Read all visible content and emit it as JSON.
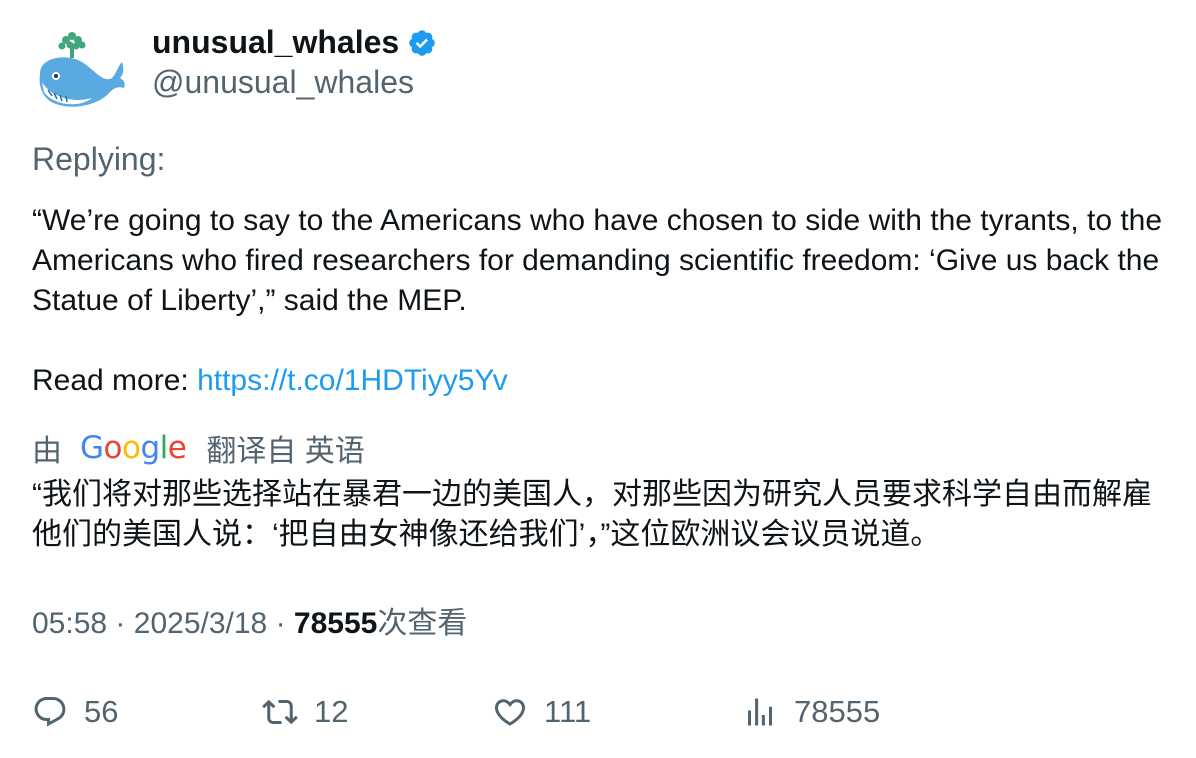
{
  "user": {
    "display_name": "unusual_whales",
    "handle": "@unusual_whales",
    "verified_icon": "verified-badge-icon",
    "avatar_icon": "whale-avatar"
  },
  "replying_label": "Replying:",
  "tweet": {
    "body": "“We’re going to say to the Americans who have chosen to side with the tyrants, to the Americans who fired researchers for demanding scientific freedom: ‘Give us back the Statue of Liberty’,” said the MEP.",
    "read_more_label": "Read more: ",
    "link": "https://t.co/1HDTiyy5Yv"
  },
  "translation": {
    "by": "由",
    "provider_letters": [
      "G",
      "o",
      "o",
      "g",
      "l",
      "e"
    ],
    "from_label": "翻译自 英语",
    "text": "“我们将对那些选择站在暴君一边的美国人，对那些因为研究人员要求科学自由而解雇他们的美国人说：‘把自由女神像还给我们’，”这位欧洲议会议员说道。"
  },
  "meta": {
    "time": "05:58",
    "separator": "·",
    "date": "2025/3/18",
    "views_count": "78555",
    "views_label": "次查看"
  },
  "actions": {
    "replies": "56",
    "retweets": "12",
    "likes": "111",
    "views": "78555"
  },
  "colors": {
    "link": "#1d9bf0",
    "secondary_text": "#536471",
    "primary_text": "#0f1419",
    "verified": "#1d9bf0"
  }
}
